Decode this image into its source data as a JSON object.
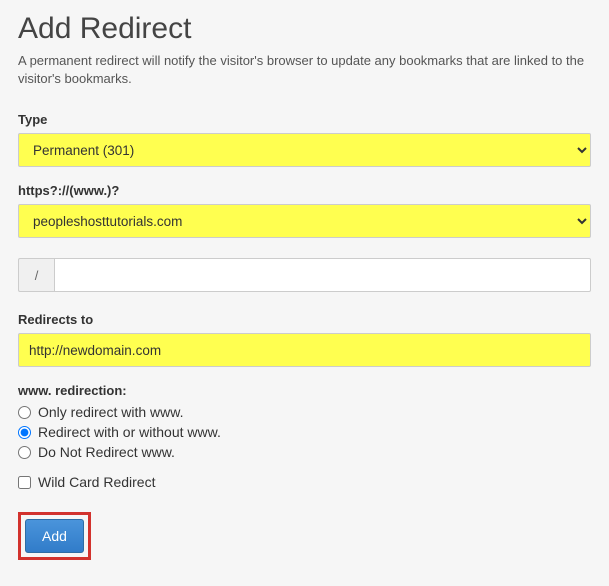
{
  "title": "Add Redirect",
  "description": "A permanent redirect will notify the visitor's browser to update any bookmarks that are linked to the visitor's bookmarks.",
  "type": {
    "label": "Type",
    "value": "Permanent (301)"
  },
  "domain": {
    "label": "https?://(www.)?",
    "value": "peopleshosttutorials.com"
  },
  "path": {
    "prefix": "/",
    "value": ""
  },
  "redirects_to": {
    "label": "Redirects to",
    "value": "http://newdomain.com"
  },
  "www_redirection": {
    "label": "www. redirection:",
    "options": [
      {
        "label": "Only redirect with www.",
        "checked": false
      },
      {
        "label": "Redirect with or without www.",
        "checked": true
      },
      {
        "label": "Do Not Redirect www.",
        "checked": false
      }
    ]
  },
  "wildcard": {
    "label": "Wild Card Redirect",
    "checked": false
  },
  "submit_label": "Add"
}
